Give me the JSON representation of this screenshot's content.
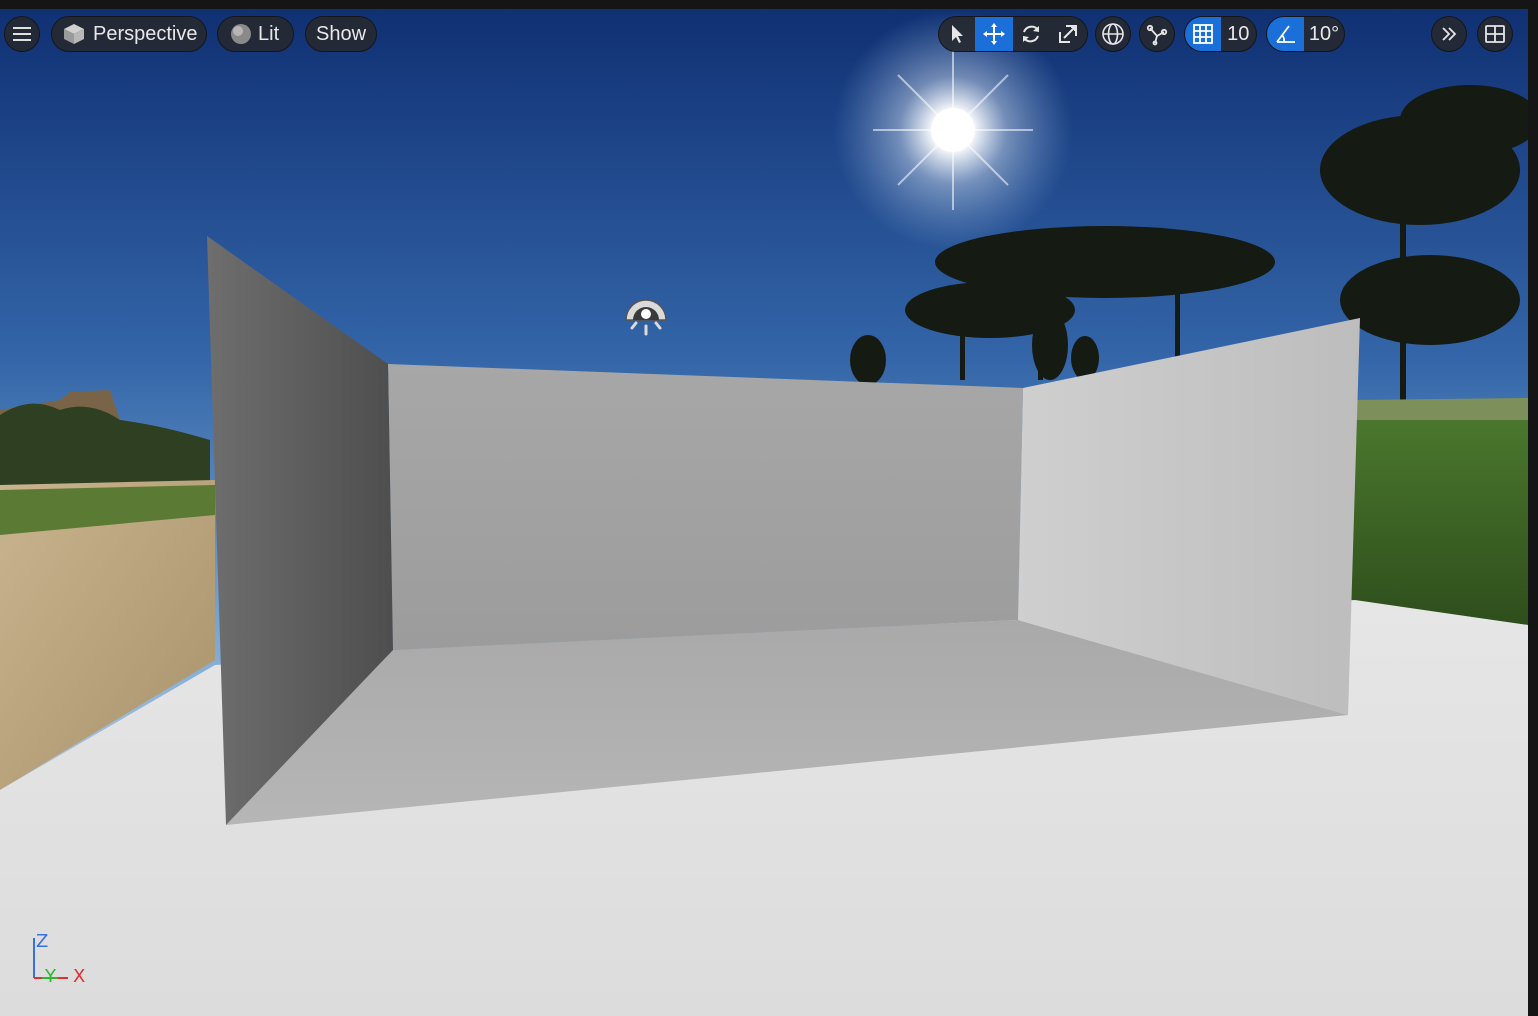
{
  "viewport_toolbar": {
    "view_mode": "Perspective",
    "lighting_mode": "Lit",
    "show_menu": "Show",
    "grid_snap_value": "10",
    "rotation_snap_value": "10°"
  },
  "axis_gizmo": {
    "z": "Z",
    "y": "Y",
    "x": "X"
  },
  "colors": {
    "active_tool": "#1b6fd8",
    "toolbar_bg": "#26282c",
    "axis_x": "#e03131",
    "axis_y": "#2fb82f",
    "axis_z": "#3a6fe0"
  },
  "icons": {
    "menu": "hamburger-icon",
    "perspective": "cube-icon",
    "lit": "sphere-icon",
    "select": "cursor-arrow-icon",
    "translate": "move-arrows-icon",
    "rotate": "rotate-icon",
    "scale": "scale-icon",
    "world_local": "globe-icon",
    "surface_snap": "surface-snap-icon",
    "grid_snap": "grid-icon",
    "rotation_snap": "angle-icon",
    "more": "double-chevron-icon",
    "layout": "viewport-layout-icon",
    "light_actor": "skylight-actor-icon"
  }
}
